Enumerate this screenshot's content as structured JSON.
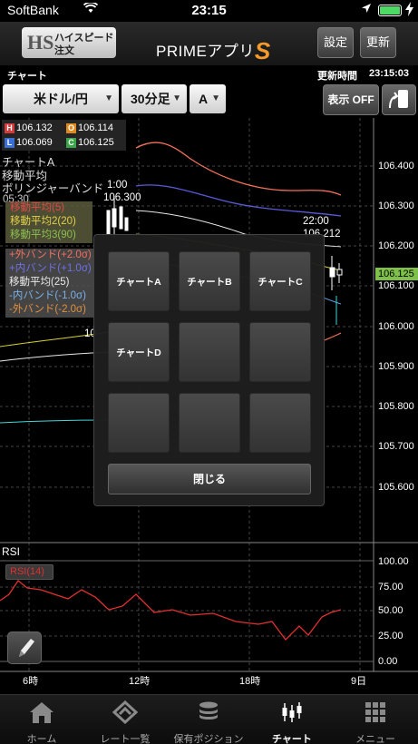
{
  "status_bar": {
    "carrier": "SoftBank",
    "time": "23:15"
  },
  "header": {
    "logo_mark": "HS",
    "logo_line1": "ハイスピード",
    "logo_line2": "注文",
    "app_title": "PRIMEアプリ",
    "app_title_suffix": "S",
    "settings_label": "設定",
    "refresh_label": "更新"
  },
  "chart_info": {
    "label": "チャート",
    "update_label": "更新時間",
    "update_time": "23:15:03"
  },
  "toolbar": {
    "currency_pair": "米ドル/円",
    "timeframe": "30分足",
    "chart_type": "A",
    "display_toggle": "表示 OFF",
    "dropdown_arrow": "▼"
  },
  "ohlc": {
    "high_key": "H",
    "high": "106.132",
    "open_key": "O",
    "open": "106.114",
    "low_key": "L",
    "low": "106.069",
    "close_key": "C",
    "close": "106.125"
  },
  "legend": {
    "chart_name": "チャートA",
    "indicator1": "移動平均",
    "indicator2": "ボリンジャーバンド",
    "ma_items": [
      "移動平均(5)",
      "移動平均2(20)",
      "移動平均3(90)"
    ],
    "bb_items": [
      "+外バンド(+2.0σ)",
      "+内バンド(+1.0σ)",
      "移動平均(25)",
      "-内バンド(-1.0σ)",
      "-外バンド(-2.0σ)"
    ],
    "annotations": [
      "1:00",
      "106.300",
      "05:30",
      "22:00",
      "106.212",
      "10"
    ]
  },
  "price_axis": [
    "106.400",
    "106.300",
    "106.200",
    "106.100",
    "106.000",
    "105.900",
    "105.800",
    "105.700",
    "105.600"
  ],
  "current_price": "106.125",
  "rsi": {
    "label": "RSI",
    "badge": "RSI(14)",
    "axis": [
      "100.00",
      "75.00",
      "50.00",
      "25.00",
      "0.00"
    ]
  },
  "x_axis": [
    "6時",
    "12時",
    "18時",
    "9日"
  ],
  "modal": {
    "tiles": [
      "チャートA",
      "チャートB",
      "チャートC",
      "チャートD",
      "",
      "",
      "",
      "",
      ""
    ],
    "close_label": "閉じる"
  },
  "tabbar": {
    "tabs": [
      {
        "label": "ホーム",
        "icon": "home-icon"
      },
      {
        "label": "レート一覧",
        "icon": "rate-list-icon"
      },
      {
        "label": "保有ポジション",
        "icon": "position-icon"
      },
      {
        "label": "チャート",
        "icon": "chart-icon"
      },
      {
        "label": "メニュー",
        "icon": "menu-grid-icon"
      }
    ],
    "active_tab": "チャート"
  },
  "colors": {
    "high": "#d63b3b",
    "open": "#e08a1e",
    "low": "#3a6fd6",
    "close": "#3aa64a",
    "price_tag": "#7ec04a",
    "rsi_line": "#e03030",
    "accent_s": "#f39a2a"
  }
}
